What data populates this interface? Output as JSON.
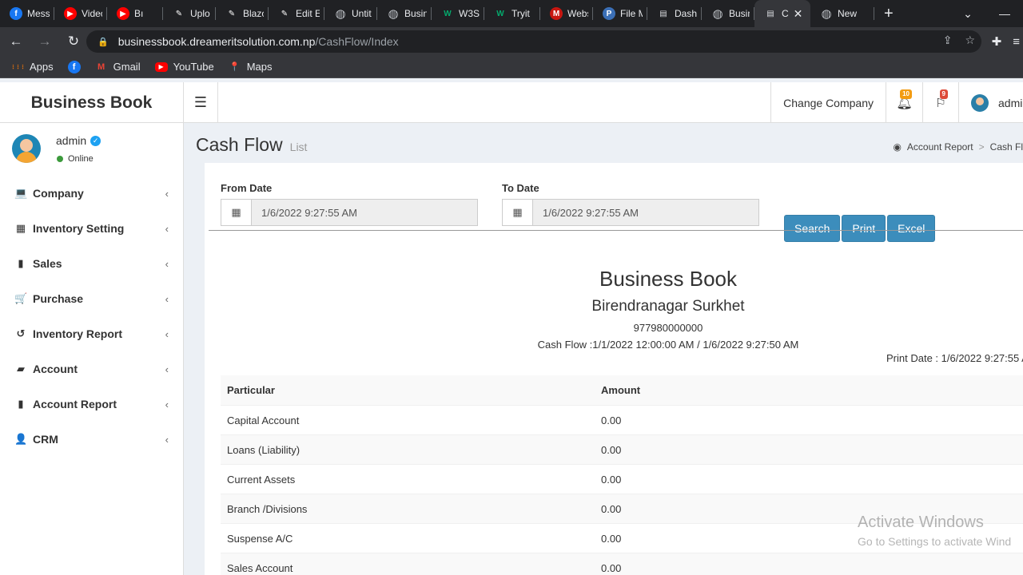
{
  "browser": {
    "tabs": [
      {
        "label": "Mess",
        "icon": "facebook-icon",
        "color": "#1877f2",
        "glyph": "f"
      },
      {
        "label": "Videc",
        "icon": "youtube-icon",
        "color": "#ff0000",
        "glyph": "▶"
      },
      {
        "label": "Bı",
        "icon": "youtube-icon",
        "color": "#ff0000",
        "glyph": "▶"
      },
      {
        "label": "Uplo",
        "icon": "page-icon",
        "color": "#ffffff",
        "glyph": "✎"
      },
      {
        "label": "Blazo",
        "icon": "page-icon",
        "color": "#ffffff",
        "glyph": "✎"
      },
      {
        "label": "Edit E",
        "icon": "page-icon",
        "color": "#ffffff",
        "glyph": "✎"
      },
      {
        "label": "Untit",
        "icon": "globe-icon",
        "color": "#bdc1c6",
        "glyph": "◍"
      },
      {
        "label": "Busin",
        "icon": "globe-icon",
        "color": "#bdc1c6",
        "glyph": "◍"
      },
      {
        "label": "W3Sc",
        "icon": "w3schools-icon",
        "color": "#04aa6d",
        "glyph": "W"
      },
      {
        "label": "Tryit",
        "icon": "w3schools-icon",
        "color": "#04aa6d",
        "glyph": "W"
      },
      {
        "label": "Webs",
        "icon": "gmail-icon",
        "color": "#c71610",
        "glyph": "M"
      },
      {
        "label": "File M",
        "icon": "p-icon",
        "color": "#3b6fb6",
        "glyph": "P"
      },
      {
        "label": "Dashl",
        "icon": "doc-icon",
        "color": "#dadce0",
        "glyph": "▤"
      },
      {
        "label": "Busin",
        "icon": "globe-icon",
        "color": "#bdc1c6",
        "glyph": "◍"
      },
      {
        "label": "C",
        "icon": "doc-icon",
        "color": "#dadce0",
        "glyph": "▤",
        "active": true
      },
      {
        "label": "New",
        "icon": "globe-icon",
        "color": "#bdc1c6",
        "glyph": "◍"
      }
    ],
    "url_host": "businessbook.dreameritsolution.com.np",
    "url_path": "/CashFlow/Index",
    "bookmarks": [
      {
        "label": "Apps",
        "icon": "apps-icon"
      },
      {
        "label": "",
        "icon": "facebook-icon"
      },
      {
        "label": "Gmail",
        "icon": "gmail-icon"
      },
      {
        "label": "YouTube",
        "icon": "youtube-icon"
      },
      {
        "label": "Maps",
        "icon": "maps-icon"
      }
    ]
  },
  "header": {
    "brand": "Business Book",
    "change_company": "Change Company",
    "notifications_count": "10",
    "flags_count": "9",
    "user": "admi",
    "colors": {
      "notif_badge": "#f39c12",
      "flag_badge": "#dd4b39"
    }
  },
  "sidebar": {
    "user_name": "admin",
    "status": "Online",
    "items": [
      {
        "label": "Company",
        "icon": "laptop-icon",
        "glyph": "💻"
      },
      {
        "label": "Inventory Setting",
        "icon": "grid-icon",
        "glyph": "▦"
      },
      {
        "label": "Sales",
        "icon": "file-icon",
        "glyph": "▮"
      },
      {
        "label": "Purchase",
        "icon": "cart-icon",
        "glyph": "🛒"
      },
      {
        "label": "Inventory Report",
        "icon": "history-icon",
        "glyph": "↺"
      },
      {
        "label": "Account",
        "icon": "book-icon",
        "glyph": "▰"
      },
      {
        "label": "Account Report",
        "icon": "report-icon",
        "glyph": "▮"
      },
      {
        "label": "CRM",
        "icon": "user-plus-icon",
        "glyph": "👤"
      }
    ]
  },
  "page": {
    "title": "Cash Flow",
    "subtitle": "List",
    "breadcrumb": [
      "Account Report",
      "Cash Fl"
    ]
  },
  "filters": {
    "from_label": "From Date",
    "from_value": "1/6/2022 9:27:55 AM",
    "to_label": "To Date",
    "to_value": "1/6/2022 9:27:55 AM",
    "search": "Search",
    "print": "Print",
    "excel": "Excel"
  },
  "report": {
    "company": "Business Book",
    "address": "Birendranagar Surkhet",
    "phone": "977980000000",
    "range": "Cash Flow :1/1/2022 12:00:00 AM / 1/6/2022 9:27:50 AM",
    "print_date": "Print Date : 1/6/2022 9:27:55 A",
    "columns": [
      "Particular",
      "Amount"
    ],
    "rows": [
      [
        "Capital Account",
        "0.00"
      ],
      [
        "Loans (Liability)",
        "0.00"
      ],
      [
        "Current Assets",
        "0.00"
      ],
      [
        "Branch /Divisions",
        "0.00"
      ],
      [
        "Suspense A/C",
        "0.00"
      ],
      [
        "Sales Account",
        "0.00"
      ]
    ]
  },
  "watermark": {
    "line1": "Activate Windows",
    "line2": "Go to Settings to activate Wind"
  }
}
